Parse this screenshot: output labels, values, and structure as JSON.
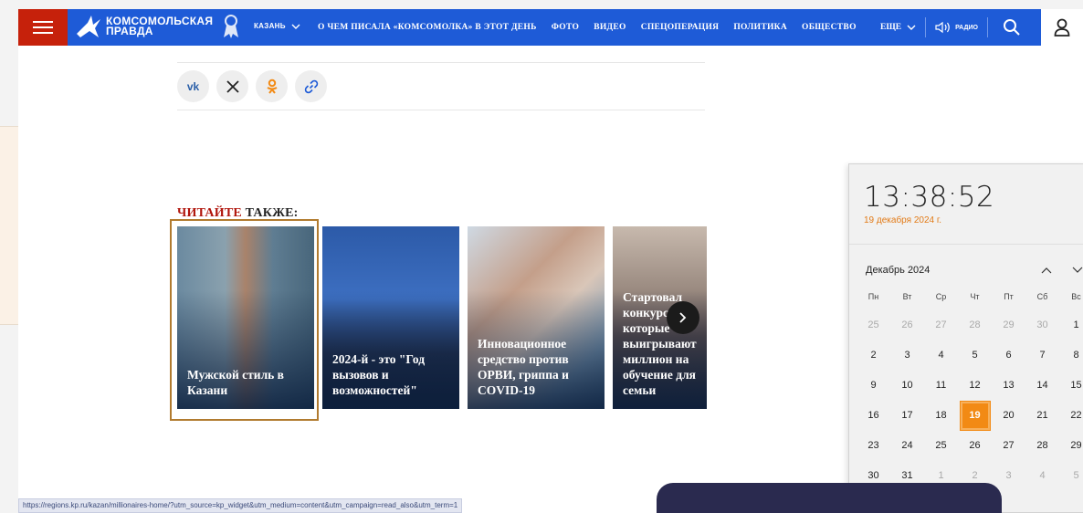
{
  "nav": {
    "logo_line1": "КОМСОМОЛЬСКАЯ",
    "logo_line2": "ПРАВДА",
    "region": "КАЗАНЬ",
    "links": [
      "О ЧЕМ ПИСАЛА «КОМСОМОЛКА» В ЭТОТ ДЕНЬ",
      "ФОТО",
      "ВИДЕО",
      "СПЕЦОПЕРАЦИЯ",
      "ПОЛИТИКА",
      "ОБЩЕСТВО"
    ],
    "more": "ЕЩЕ",
    "radio": "РАДИО"
  },
  "share": {
    "buttons": [
      {
        "icon": "vk-icon",
        "label": "vk"
      },
      {
        "icon": "x-icon",
        "label": "𝕏"
      },
      {
        "icon": "odnoklassniki-icon",
        "label": "ok"
      },
      {
        "icon": "link-icon",
        "label": "link"
      }
    ]
  },
  "read_also": {
    "heading_red": "ЧИТАЙТЕ",
    "heading_dark": "ТАКЖЕ:",
    "cards": [
      {
        "title": "Мужской стиль в Казани"
      },
      {
        "title": "2024-й - это \"Год вызовов и возможностей\""
      },
      {
        "title": "Инновационное средство против ОРВИ, гриппа и COVID-19"
      },
      {
        "title": "Стартовал конкурс, которые выигрывают миллион на обучение для семьи"
      }
    ]
  },
  "clock": {
    "time": "13:38:52",
    "date": "19 декабря 2024 г.",
    "month": "Декабрь 2024",
    "weekdays": [
      "Пн",
      "Вт",
      "Ср",
      "Чт",
      "Пт",
      "Сб",
      "Вс"
    ],
    "weeks": [
      [
        "25",
        "26",
        "27",
        "28",
        "29",
        "30",
        "1"
      ],
      [
        "2",
        "3",
        "4",
        "5",
        "6",
        "7",
        "8"
      ],
      [
        "9",
        "10",
        "11",
        "12",
        "13",
        "14",
        "15"
      ],
      [
        "16",
        "17",
        "18",
        "19",
        "20",
        "21",
        "22"
      ],
      [
        "23",
        "24",
        "25",
        "26",
        "27",
        "28",
        "29"
      ],
      [
        "30",
        "31",
        "1",
        "2",
        "3",
        "4",
        "5"
      ]
    ],
    "today": "19"
  },
  "status_url": "https://regions.kp.ru/kazan/millionaires-home/?utm_source=kp_widget&utm_medium=content&utm_campaign=read_also&utm_term=1",
  "colors": {
    "nav_blue": "#1e5bd7",
    "brand_red": "#c6210b",
    "today_orange": "#f28a14"
  }
}
